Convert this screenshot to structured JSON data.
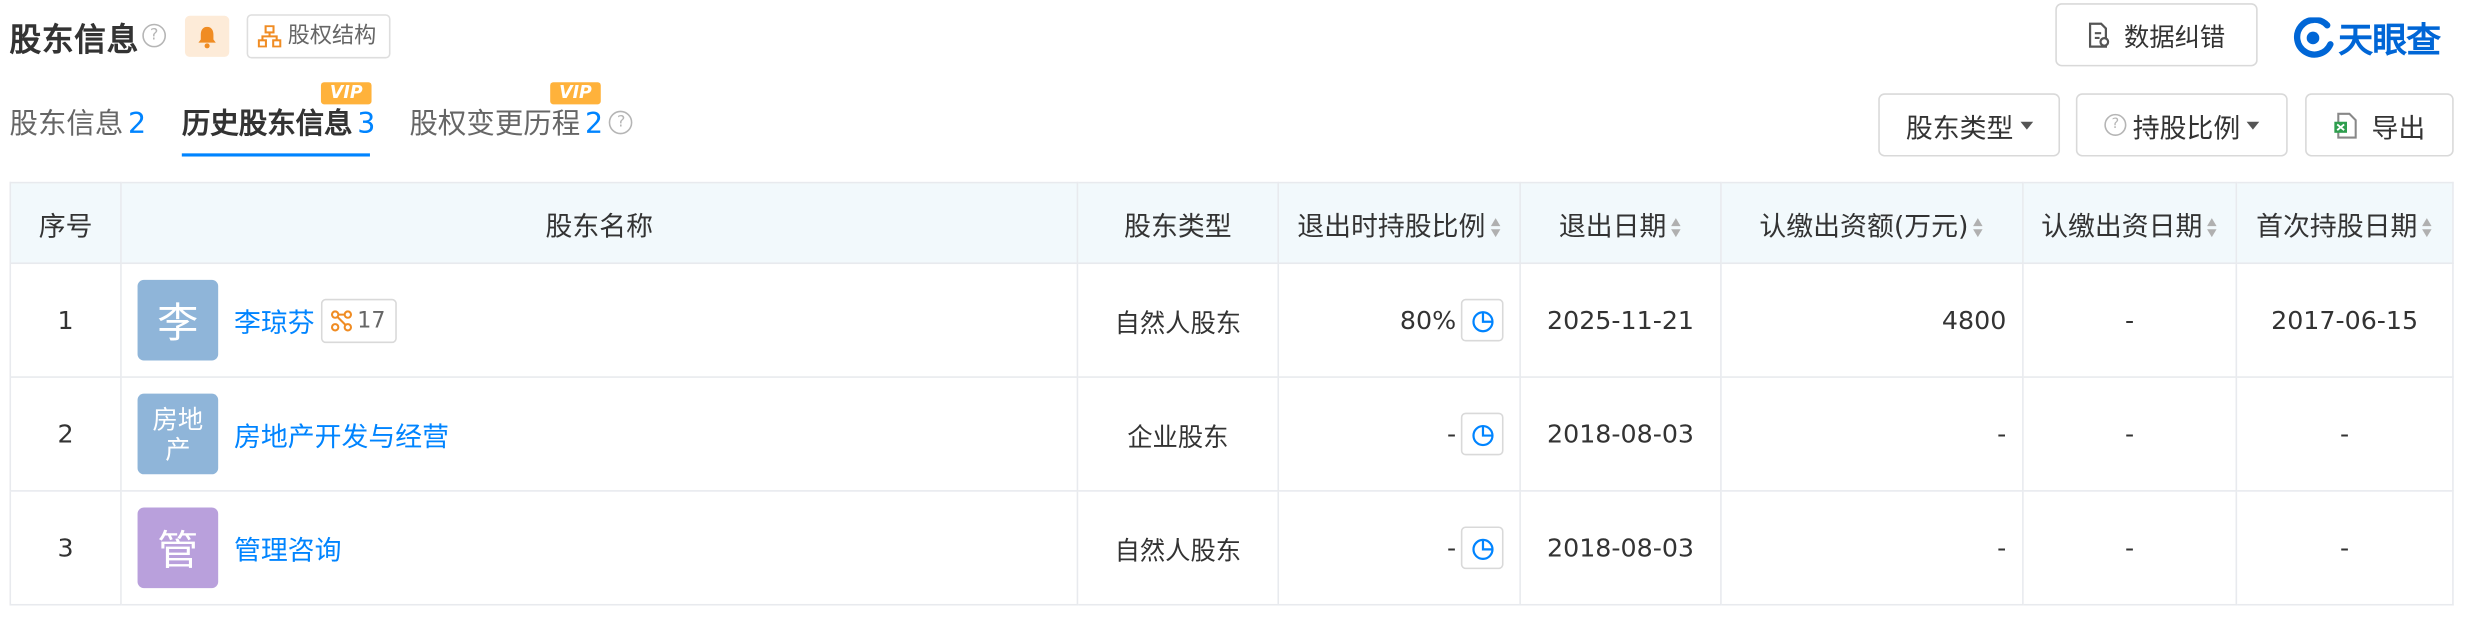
{
  "header": {
    "title": "股东信息",
    "help_glyph": "?",
    "equity_button": "股权结构",
    "correct_button": "数据纠错",
    "logo_text": "天眼查"
  },
  "tabs": [
    {
      "label": "股东信息",
      "count": "2",
      "active": false,
      "vip": false
    },
    {
      "label": "历史股东信息",
      "count": "3",
      "active": true,
      "vip": true
    },
    {
      "label": "股权变更历程",
      "count": "2",
      "active": false,
      "vip": true
    }
  ],
  "vip_label": "VIP",
  "filters": {
    "holder_type": "股东类型",
    "ratio": "持股比例",
    "export": "导出"
  },
  "table": {
    "headers": {
      "index": "序号",
      "name": "股东名称",
      "type": "股东类型",
      "exit_ratio": "退出时持股比例",
      "exit_date": "退出日期",
      "amount": "认缴出资额(万元)",
      "sub_date": "认缴出资日期",
      "first_date": "首次持股日期"
    },
    "rows": [
      {
        "index": "1",
        "avatar_text": "李",
        "avatar_color": "#8fb5d9",
        "name": "李琼芬",
        "relation_count": "17",
        "type": "自然人股东",
        "exit_ratio": "80%",
        "exit_date": "2025-11-21",
        "amount": "4800",
        "sub_date": "-",
        "first_date": "2017-06-15"
      },
      {
        "index": "2",
        "avatar_text": "房地产",
        "avatar_color": "#8fb5d9",
        "name": "房地产开发与经营",
        "relation_count": "",
        "type": "企业股东",
        "exit_ratio": "-",
        "exit_date": "2018-08-03",
        "amount": "-",
        "sub_date": "-",
        "first_date": "-"
      },
      {
        "index": "3",
        "avatar_text": "管",
        "avatar_color": "#b9a0dc",
        "name": "管理咨询",
        "relation_count": "",
        "type": "自然人股东",
        "exit_ratio": "-",
        "exit_date": "2018-08-03",
        "amount": "-",
        "sub_date": "-",
        "first_date": "-"
      }
    ]
  },
  "colors": {
    "accent": "#0084ff",
    "vip": "#ffb23b",
    "header_bg": "#f2f9fc",
    "logo": "#0066d6"
  }
}
